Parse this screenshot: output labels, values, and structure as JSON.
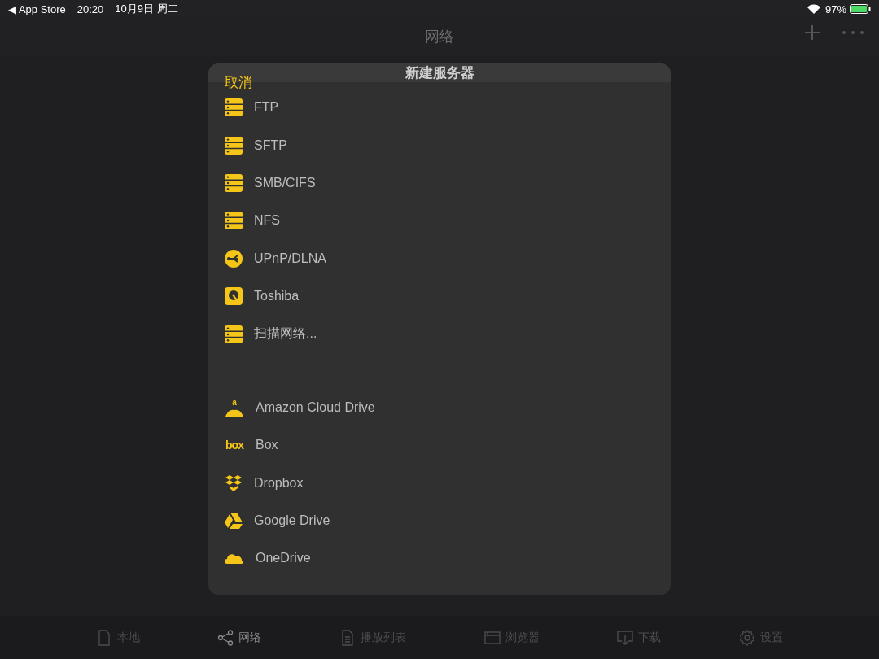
{
  "status_bar": {
    "back_label": "◀ App Store",
    "time": "20:20",
    "date": "10月9日 周二",
    "battery": "97%"
  },
  "nav": {
    "title": "网络"
  },
  "dialog": {
    "cancel": "取消",
    "title": "新建服务器",
    "sections": [
      [
        {
          "label": "FTP",
          "kind": "server"
        },
        {
          "label": "SFTP",
          "kind": "server"
        },
        {
          "label": "SMB/CIFS",
          "kind": "server"
        },
        {
          "label": "NFS",
          "kind": "server"
        },
        {
          "label": "UPnP/DLNA",
          "kind": "upnp"
        },
        {
          "label": "Toshiba",
          "kind": "disk"
        },
        {
          "label": "扫描网络...",
          "kind": "server"
        }
      ],
      [
        {
          "label": "Amazon Cloud Drive",
          "kind": "amazon",
          "icon_text": "a"
        },
        {
          "label": "Box",
          "kind": "box",
          "icon_text": "box"
        },
        {
          "label": "Dropbox",
          "kind": "dropbox"
        },
        {
          "label": "Google Drive",
          "kind": "gdrive"
        },
        {
          "label": "OneDrive",
          "kind": "onedrive"
        }
      ]
    ]
  },
  "tabs": [
    {
      "label": "本地",
      "kind": "file",
      "selected": false
    },
    {
      "label": "网络",
      "kind": "share",
      "selected": true
    },
    {
      "label": "播放列表",
      "kind": "list",
      "selected": false
    },
    {
      "label": "浏览器",
      "kind": "browser",
      "selected": false
    },
    {
      "label": "下载",
      "kind": "download",
      "selected": false
    },
    {
      "label": "设置",
      "kind": "gear",
      "selected": false
    }
  ]
}
